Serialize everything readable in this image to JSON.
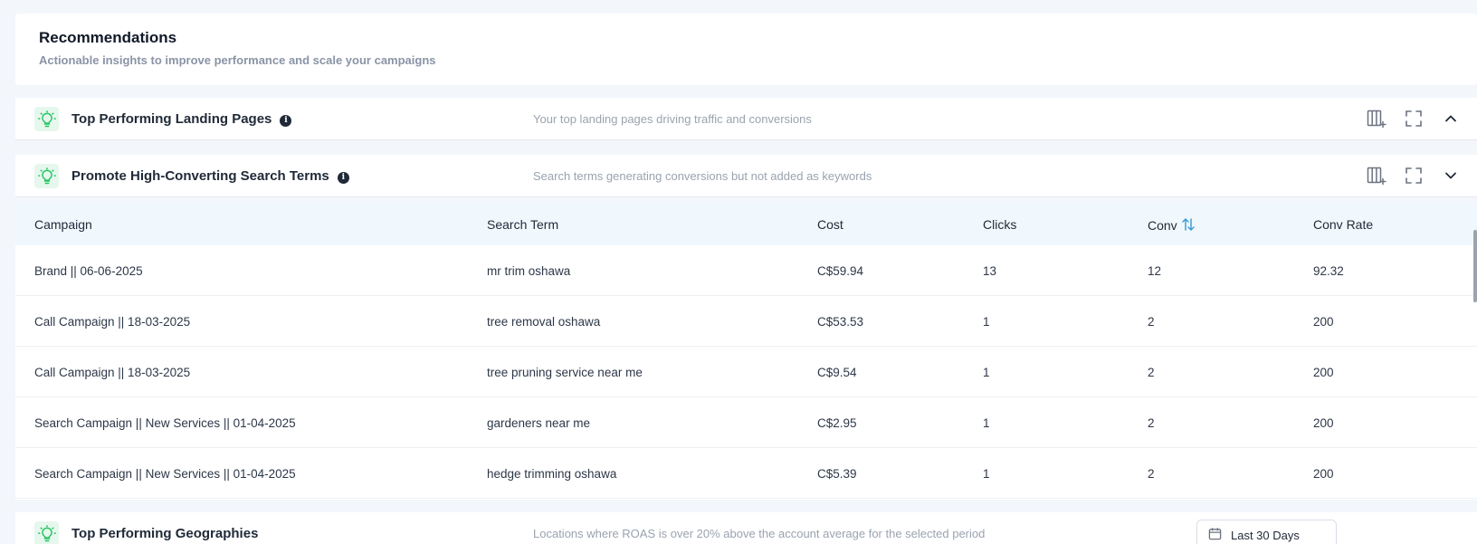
{
  "header": {
    "title": "Recommendations",
    "subtitle": "Actionable insights to improve performance and scale your campaigns"
  },
  "sections": [
    {
      "title": "Top Performing Landing Pages",
      "description": "Your top landing pages driving traffic and conversions",
      "expanded": false
    },
    {
      "title": "Promote High-Converting Search Terms",
      "description": "Search terms generating conversions but not added as keywords",
      "expanded": true
    },
    {
      "title": "Top Performing Geographies",
      "description": "Locations where ROAS is over 20% above the account average for the selected period",
      "expanded": false,
      "date_range": "Last 30 Days"
    }
  ],
  "table": {
    "columns": [
      "Campaign",
      "Search Term",
      "Cost",
      "Clicks",
      "Conv",
      "Conv Rate"
    ],
    "rows": [
      [
        "Brand || 06-06-2025",
        "mr trim oshawa",
        "C$59.94",
        "13",
        "12",
        "92.32"
      ],
      [
        "Call Campaign || 18-03-2025",
        "tree removal oshawa",
        "C$53.53",
        "1",
        "2",
        "200"
      ],
      [
        "Call Campaign || 18-03-2025",
        "tree pruning service near me",
        "C$9.54",
        "1",
        "2",
        "200"
      ],
      [
        "Search Campaign || New Services || 01-04-2025",
        "gardeners near me",
        "C$2.95",
        "1",
        "2",
        "200"
      ],
      [
        "Search Campaign || New Services || 01-04-2025",
        "hedge trimming oshawa",
        "C$5.39",
        "1",
        "2",
        "200"
      ]
    ]
  },
  "colors": {
    "accent_green": "#22c55e",
    "sort_blue": "#3b9ed8",
    "table_header_bg": "#f0f8fd"
  },
  "icons": {
    "section": "lightbulb-icon",
    "info": "info-icon",
    "columns": "columns-add-icon",
    "fullscreen": "fullscreen-icon",
    "collapse": "chevron-up-icon",
    "expand": "chevron-down-icon",
    "sort": "sort-icon",
    "calendar": "calendar-icon"
  }
}
